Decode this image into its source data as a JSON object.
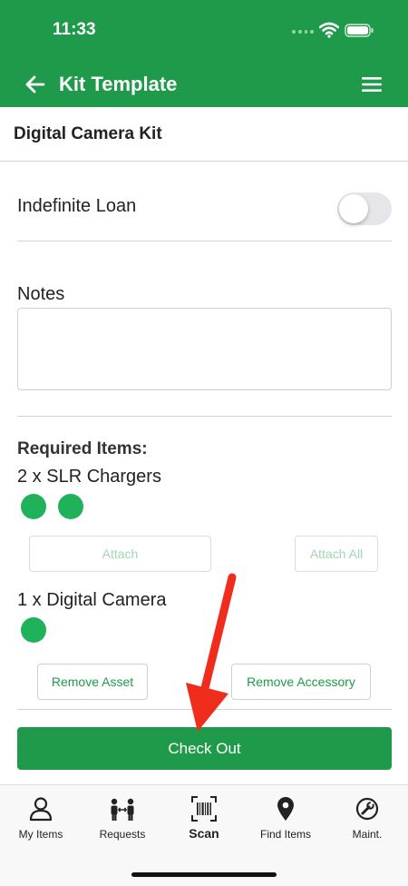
{
  "status": {
    "time": "11:33"
  },
  "header": {
    "title": "Kit Template"
  },
  "kit": {
    "title": "Digital Camera Kit"
  },
  "loan": {
    "label": "Indefinite Loan",
    "enabled": false
  },
  "notes": {
    "label": "Notes",
    "value": "",
    "placeholder": ""
  },
  "required": {
    "title": "Required Items:",
    "items": [
      {
        "label": "2 x SLR Chargers",
        "attached_count": 2
      },
      {
        "label": "1 x Digital Camera",
        "attached_count": 1
      }
    ]
  },
  "buttons": {
    "attach": "Attach",
    "attach_all": "Attach All",
    "remove_asset": "Remove Asset",
    "remove_accessory": "Remove Accessory",
    "checkout": "Check Out"
  },
  "tabs": [
    {
      "label": "My Items",
      "icon": "person-icon"
    },
    {
      "label": "Requests",
      "icon": "people-exchange-icon"
    },
    {
      "label": "Scan",
      "icon": "barcode-scan-icon",
      "active": true
    },
    {
      "label": "Find Items",
      "icon": "map-pin-icon"
    },
    {
      "label": "Maint.",
      "icon": "wrench-icon"
    }
  ],
  "colors": {
    "brand": "#1f9a4a",
    "dot": "#1fb25a",
    "arrow": "#f02d1c"
  }
}
